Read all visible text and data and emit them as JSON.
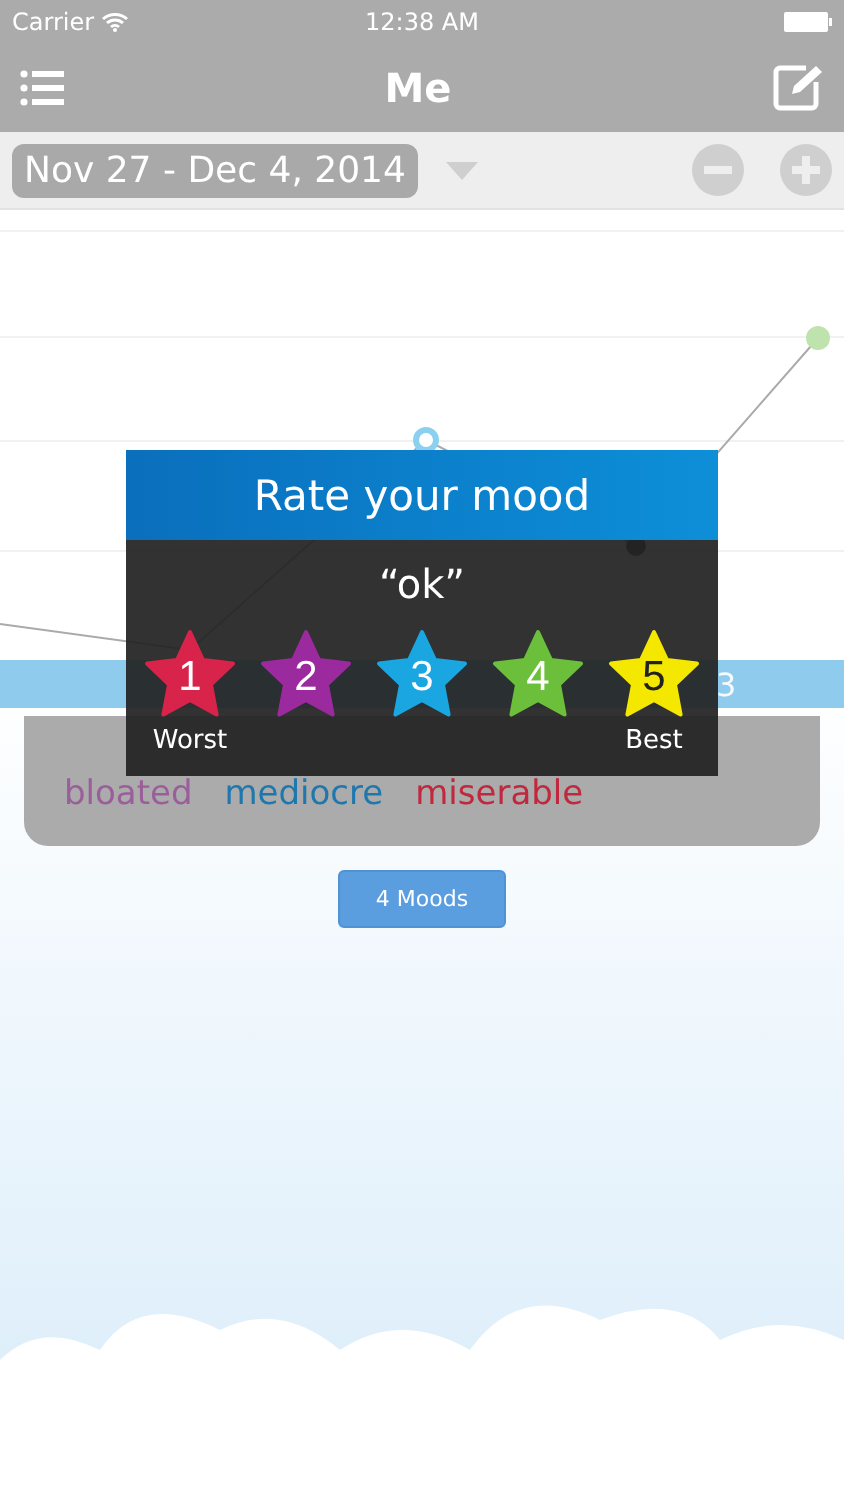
{
  "status_bar": {
    "carrier": "Carrier",
    "time": "12:38 AM"
  },
  "nav_bar": {
    "title": "Me"
  },
  "date_range": {
    "label": "Nov 27 - Dec 4, 2014"
  },
  "axis": {
    "labels": [
      "3"
    ]
  },
  "mood_tags": [
    {
      "label": "bloated",
      "color": "#9a5f9a"
    },
    {
      "label": "mediocre",
      "color": "#1f78ad"
    },
    {
      "label": "miserable",
      "color": "#c0283e"
    }
  ],
  "moods_button": {
    "label": "4 Moods"
  },
  "dialog": {
    "title": "Rate your mood",
    "quote": "“ok”",
    "stars": [
      {
        "label": "1",
        "color": "#d8234a",
        "caption": "Worst"
      },
      {
        "label": "2",
        "color": "#9b2a9e"
      },
      {
        "label": "3",
        "color": "#1aa6e0"
      },
      {
        "label": "4",
        "color": "#6cbf3a"
      },
      {
        "label": "5",
        "color": "#f5e800",
        "caption": "Best"
      }
    ]
  }
}
